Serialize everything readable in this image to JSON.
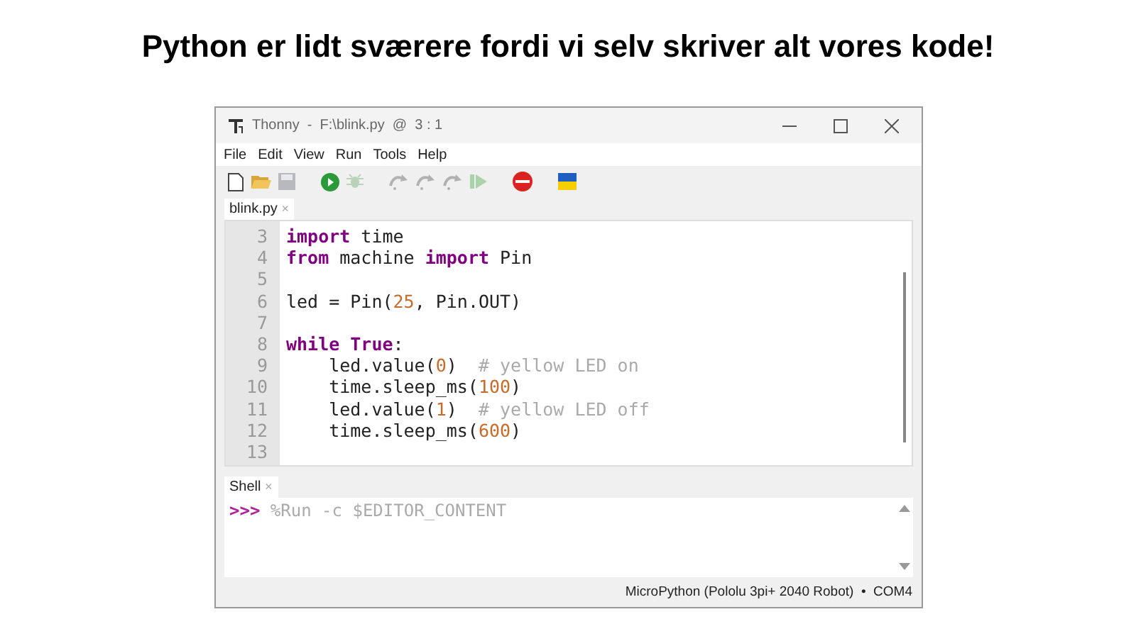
{
  "heading": "Python er lidt sværere fordi vi selv skriver alt vores kode!",
  "window": {
    "title": "Thonny  -  F:\\blink.py  @  3 : 1"
  },
  "menu": [
    "File",
    "Edit",
    "View",
    "Run",
    "Tools",
    "Help"
  ],
  "toolbar": [
    {
      "kind": "new",
      "disabled": false
    },
    {
      "kind": "open",
      "disabled": false
    },
    {
      "kind": "save",
      "disabled": true
    },
    {
      "kind": "gap"
    },
    {
      "kind": "run",
      "disabled": false
    },
    {
      "kind": "debug",
      "disabled": true
    },
    {
      "kind": "gap"
    },
    {
      "kind": "step-over",
      "disabled": true
    },
    {
      "kind": "step-into",
      "disabled": true
    },
    {
      "kind": "step-out",
      "disabled": true
    },
    {
      "kind": "resume",
      "disabled": true
    },
    {
      "kind": "gap"
    },
    {
      "kind": "stop",
      "disabled": false
    },
    {
      "kind": "gap"
    },
    {
      "kind": "flag",
      "disabled": false
    }
  ],
  "editor_tab": {
    "label": "blink.py",
    "close": "×"
  },
  "code": [
    {
      "number": "3",
      "tokens": [
        {
          "kind": "kw",
          "text": "import"
        },
        {
          "kind": "plain",
          "text": " time"
        }
      ]
    },
    {
      "number": "4",
      "tokens": [
        {
          "kind": "kw",
          "text": "from"
        },
        {
          "kind": "plain",
          "text": " machine "
        },
        {
          "kind": "kw",
          "text": "import"
        },
        {
          "kind": "plain",
          "text": " Pin"
        }
      ]
    },
    {
      "number": "5"
    },
    {
      "number": "6",
      "tokens": [
        {
          "kind": "plain",
          "text": "led = Pin("
        },
        {
          "kind": "num",
          "text": "25"
        },
        {
          "kind": "plain",
          "text": ", Pin.OUT)"
        }
      ]
    },
    {
      "number": "7"
    },
    {
      "number": "8",
      "tokens": [
        {
          "kind": "kw",
          "text": "while True"
        },
        {
          "kind": "plain",
          "text": ":"
        }
      ]
    },
    {
      "number": "9",
      "tokens": [
        {
          "kind": "plain",
          "text": "    led.value("
        },
        {
          "kind": "num",
          "text": "0"
        },
        {
          "kind": "plain",
          "text": ")  "
        },
        {
          "kind": "comment",
          "text": "# yellow LED on"
        }
      ]
    },
    {
      "number": "10",
      "tokens": [
        {
          "kind": "plain",
          "text": "    time.sleep_ms("
        },
        {
          "kind": "num",
          "text": "100"
        },
        {
          "kind": "plain",
          "text": ")"
        }
      ]
    },
    {
      "number": "11",
      "tokens": [
        {
          "kind": "plain",
          "text": "    led.value("
        },
        {
          "kind": "num",
          "text": "1"
        },
        {
          "kind": "plain",
          "text": ")  "
        },
        {
          "kind": "comment",
          "text": "# yellow LED off"
        }
      ]
    },
    {
      "number": "12",
      "tokens": [
        {
          "kind": "plain",
          "text": "    time.sleep_ms("
        },
        {
          "kind": "num",
          "text": "600"
        },
        {
          "kind": "plain",
          "text": ")"
        }
      ]
    },
    {
      "number": "13"
    }
  ],
  "shell_tab": {
    "label": "Shell",
    "close": "×"
  },
  "shell": {
    "prompt": ">>>",
    "command": "%Run -c $EDITOR_CONTENT"
  },
  "status_bar": "MicroPython (Pololu 3pi+ 2040 Robot)  •  COM4"
}
